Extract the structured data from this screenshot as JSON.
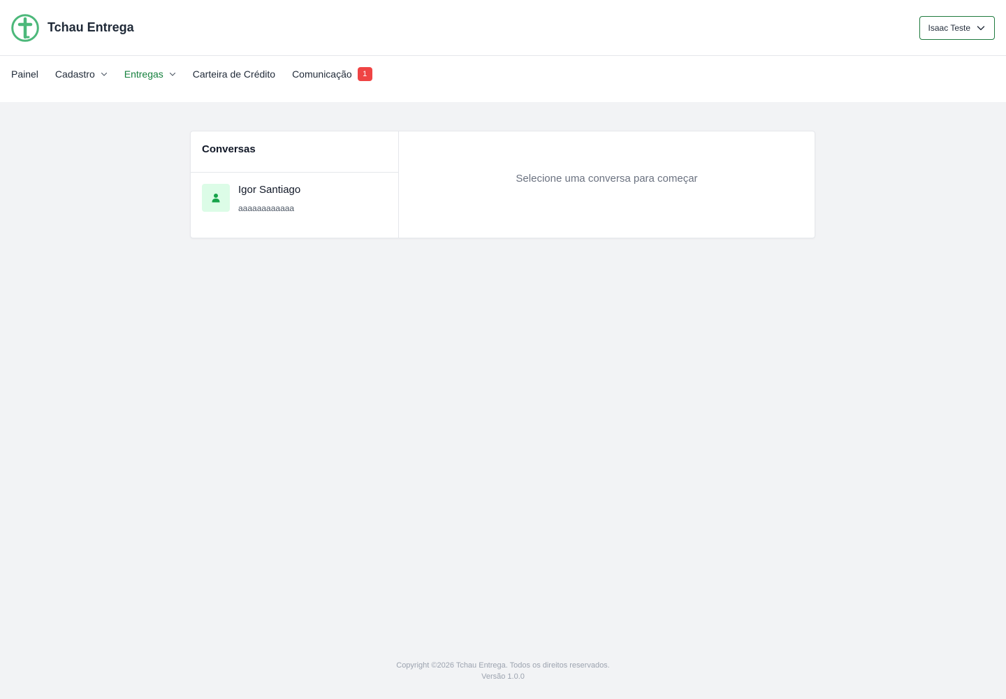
{
  "header": {
    "brand_name": "Tchau Entrega",
    "user_name": "Isaac Teste"
  },
  "nav": {
    "items": [
      {
        "label": "Painel"
      },
      {
        "label": "Cadastro"
      },
      {
        "label": "Entregas"
      },
      {
        "label": "Carteira de Crédito"
      },
      {
        "label": "Comunicação",
        "badge": "1"
      }
    ]
  },
  "conversations": {
    "title": "Conversas",
    "items": [
      {
        "name": "Igor Santiago",
        "preview": "aaaaaaaaaaaa"
      }
    ],
    "empty_message": "Selecione uma conversa para começar"
  },
  "footer": {
    "copyright": "Copyright ©2026 Tchau Entrega. Todos os direitos reservados.",
    "version": "Versão 1.0.0"
  },
  "colors": {
    "brand_green": "#4cb87a",
    "active_nav": "#15803d",
    "badge_red": "#ef4444",
    "avatar_bg": "#dcfce7",
    "background": "#f2f3f5"
  },
  "icons": {
    "logo": "tchau-entrega-logo-icon",
    "user_dropdown": "chevron-down-icon",
    "nav_dropdown": "chevron-down-icon",
    "avatar": "user-icon"
  }
}
